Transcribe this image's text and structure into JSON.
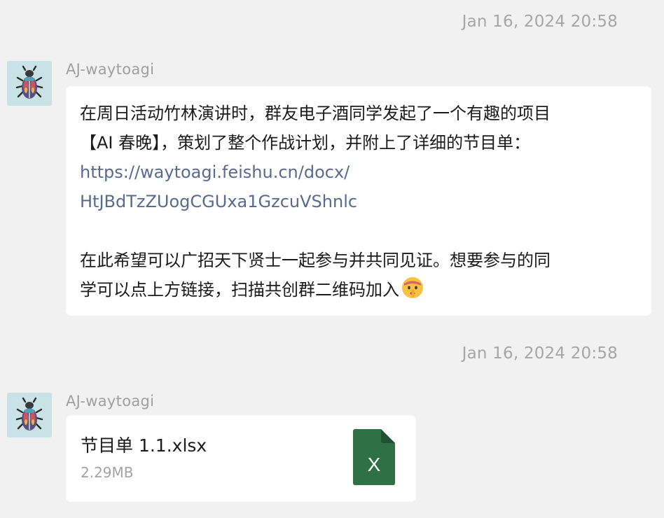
{
  "messages": [
    {
      "timestamp": "Jan 16, 2024 20:58",
      "sender": "AJ-waytoagi",
      "avatar_icon": "beetle-icon",
      "lines": [
        "在周日活动竹林演讲时，群友电子酒同学发起了一个有趣的项目",
        "【AI 春晚】，策划了整个作战计划，并附上了详细的节目单："
      ],
      "link_lines": [
        "https://waytoagi.feishu.cn/docx/",
        "HtJBdTzZUogCGUxa1GzcuVShnlc"
      ],
      "closing_lines": [
        "在此希望可以广招天下贤士一起参与并共同见证。想要参与的同",
        "学可以点上方链接，扫描共创群二维码加入"
      ],
      "emoji": "shushing-face-emoji"
    },
    {
      "timestamp": "Jan 16, 2024 20:58",
      "sender": "AJ-waytoagi",
      "avatar_icon": "beetle-icon",
      "file": {
        "name": "节目单 1.1.xlsx",
        "size": "2.29MB",
        "icon": "excel-file-icon",
        "icon_letter": "X",
        "icon_color": "#2f7045"
      }
    }
  ],
  "colors": {
    "background": "#f1f1f1",
    "bubble": "#ffffff",
    "link": "#586b8f",
    "avatar_bg": "#c9e2e6"
  }
}
